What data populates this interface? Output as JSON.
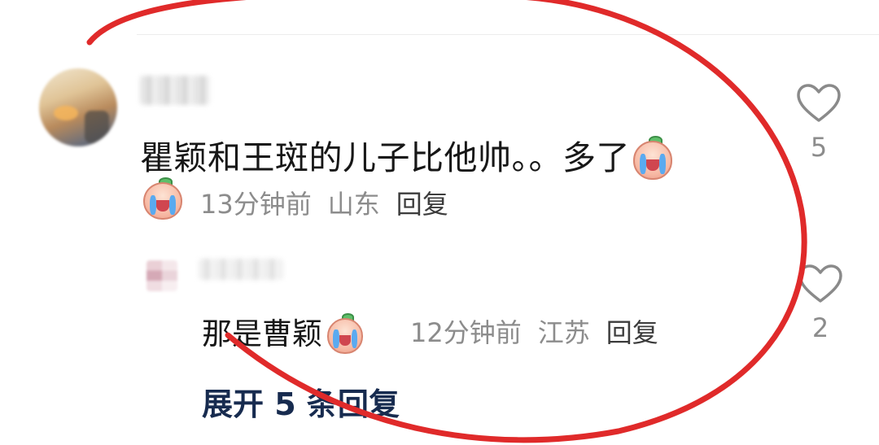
{
  "comment": {
    "text": "瞿颖和王斑的儿子比他帅。。多了",
    "time": "13分钟前",
    "location": "山东",
    "reply_label": "回复",
    "likes": "5"
  },
  "reply": {
    "text": "那是曹颖",
    "time": "12分钟前",
    "location": "江苏",
    "reply_label": "回复",
    "likes": "2"
  },
  "expand_label": "展开 5 条回复",
  "icons": {
    "emoji": "crying-laughing-peach-emoji",
    "like": "heart-outline-icon"
  },
  "colors": {
    "annotation": "#e02a2a",
    "link": "#172b4f",
    "meta": "#8c8c8c"
  }
}
